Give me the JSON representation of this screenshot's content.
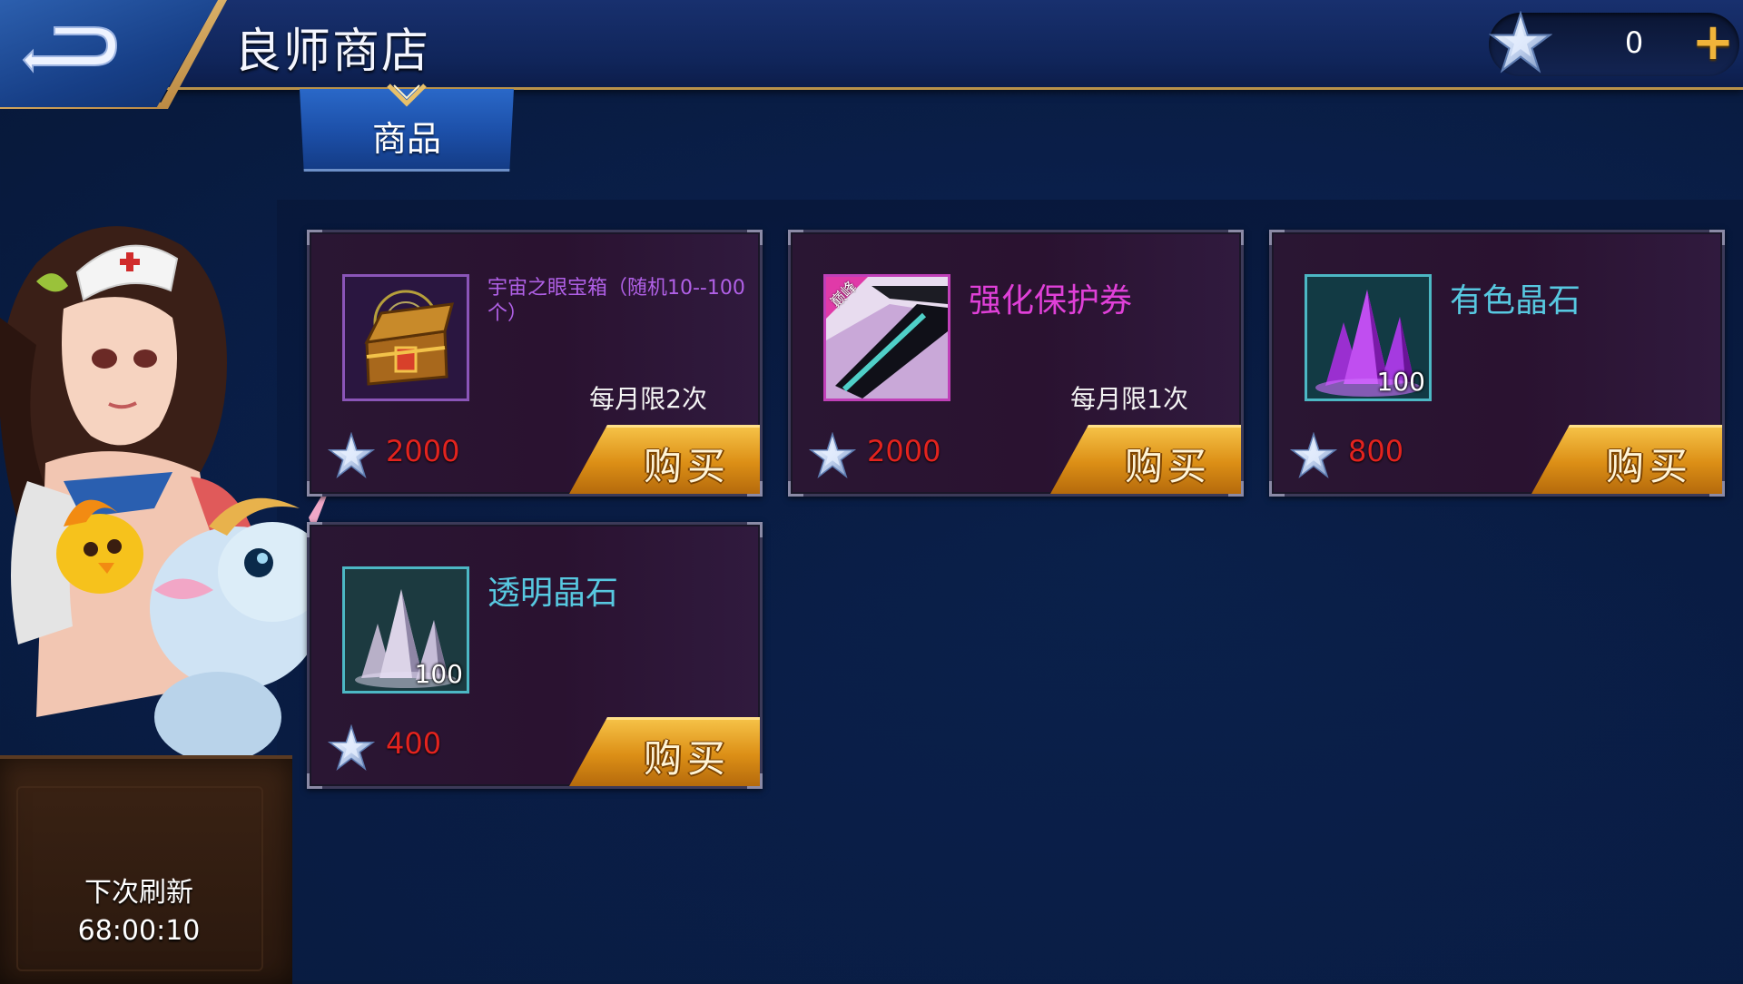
{
  "header": {
    "title": "良师商店",
    "currency": {
      "icon": "star-crystal-icon",
      "value": "0",
      "add_label": "+"
    }
  },
  "tabs": [
    {
      "label": "商品",
      "active": true
    }
  ],
  "shop_items": [
    {
      "name": "宇宙之眼宝箱（随机10--100个）",
      "name_color": "#b060e6",
      "icon": "treasure-chest-icon",
      "quantity": "",
      "limit": "每月限2次",
      "price": "2000",
      "buy_label": "购买"
    },
    {
      "name": "强化保护券",
      "name_color": "#e040d8",
      "icon": "protection-ticket-icon",
      "badge": "巅峰",
      "quantity": "",
      "limit": "每月限1次",
      "price": "2000",
      "buy_label": "购买"
    },
    {
      "name": "有色晶石",
      "name_color": "#57c8e0",
      "icon": "purple-crystal-icon",
      "quantity": "100",
      "limit": "",
      "price": "800",
      "buy_label": "购买"
    },
    {
      "name": "透明晶石",
      "name_color": "#57c8e0",
      "icon": "clear-crystal-icon",
      "quantity": "100",
      "limit": "",
      "price": "400",
      "buy_label": "购买"
    }
  ],
  "refresh": {
    "label": "下次刷新",
    "timer": "68:00:10"
  },
  "colors": {
    "price": "#e3231e",
    "buy_button": "#e6a025",
    "accent_gold": "#b9924a"
  }
}
